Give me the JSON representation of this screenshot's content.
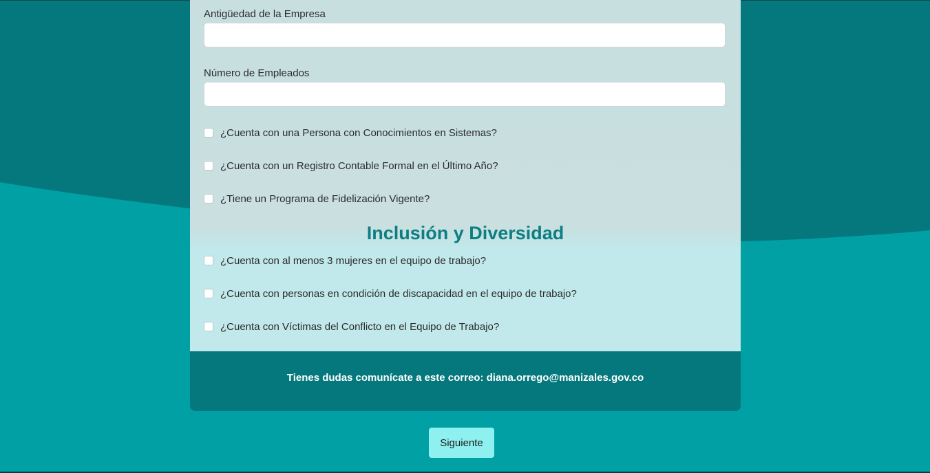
{
  "form": {
    "fields": [
      {
        "label": "Antigüedad de la Empresa",
        "value": "",
        "placeholder": ""
      },
      {
        "label": "Número de Empleados",
        "value": "",
        "placeholder": ""
      }
    ],
    "business_checks": [
      {
        "label": "¿Cuenta con una Persona con Conocimientos en Sistemas?",
        "checked": false
      },
      {
        "label": "¿Cuenta con un Registro Contable Formal en el Último Año?",
        "checked": false
      },
      {
        "label": "¿Tiene un Programa de Fidelización Vigente?",
        "checked": false
      }
    ],
    "inclusion_section": {
      "title": "Inclusión y Diversidad",
      "checks": [
        {
          "label": "¿Cuenta con al menos 3 mujeres en el equipo de trabajo?",
          "checked": false
        },
        {
          "label": "¿Cuenta con personas en condición de discapacidad en el equipo de trabajo?",
          "checked": false
        },
        {
          "label": "¿Cuenta con Víctimas del Conflicto en el Equipo de Trabajo?",
          "checked": false
        }
      ]
    }
  },
  "footer": {
    "text": "Tienes dudas comunícate a este correo: diana.orrego@manizales.gov.co"
  },
  "actions": {
    "next_label": "Siguiente"
  },
  "colors": {
    "background_dark": "#04787c",
    "background_light": "#00a0a5",
    "accent_title": "#0e7e82",
    "button": "#8ff0f0",
    "footer": "#04787c"
  }
}
